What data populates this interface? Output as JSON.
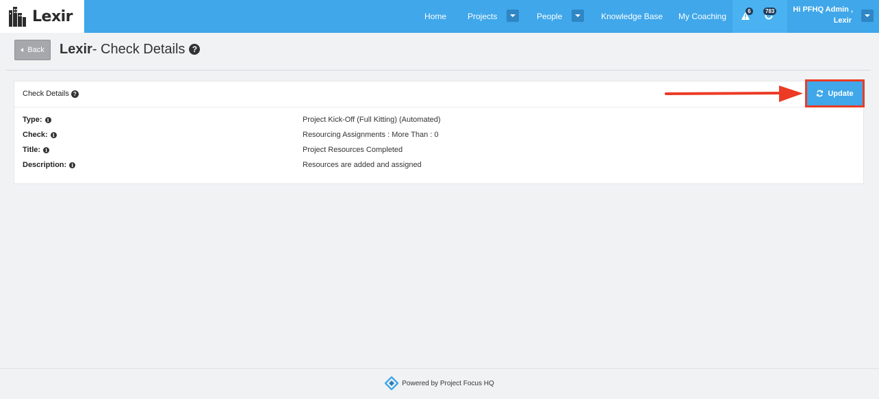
{
  "brand": {
    "logo_text": "Lexir"
  },
  "nav": {
    "items": [
      {
        "label": "Home"
      },
      {
        "label": "Projects"
      },
      {
        "label": "People"
      },
      {
        "label": "Knowledge Base"
      },
      {
        "label": "My Coaching"
      }
    ],
    "alerts_count": "6",
    "sync_count": "783",
    "user_greeting_line1": "Hi PFHQ Admin ,",
    "user_greeting_line2": "Lexir"
  },
  "header": {
    "back_label": "Back",
    "title_bold": "Lexir",
    "title_rest": "- Check Details"
  },
  "panel": {
    "title": "Check Details",
    "update_label": "Update",
    "rows": [
      {
        "label": "Type:",
        "value": "Project Kick-Off (Full Kitting) (Automated)"
      },
      {
        "label": "Check:",
        "value": "Resourcing Assignments : More Than : 0"
      },
      {
        "label": "Title:",
        "value": "Project Resources Completed"
      },
      {
        "label": "Description:",
        "value": "Resources are added and assigned"
      }
    ]
  },
  "footer": {
    "text": "Powered by Project Focus HQ"
  },
  "colors": {
    "nav_bg": "#3fa7ea",
    "accent": "#3fa7ea",
    "annotation": "#ec3b24",
    "page_bg": "#f1f2f4"
  }
}
